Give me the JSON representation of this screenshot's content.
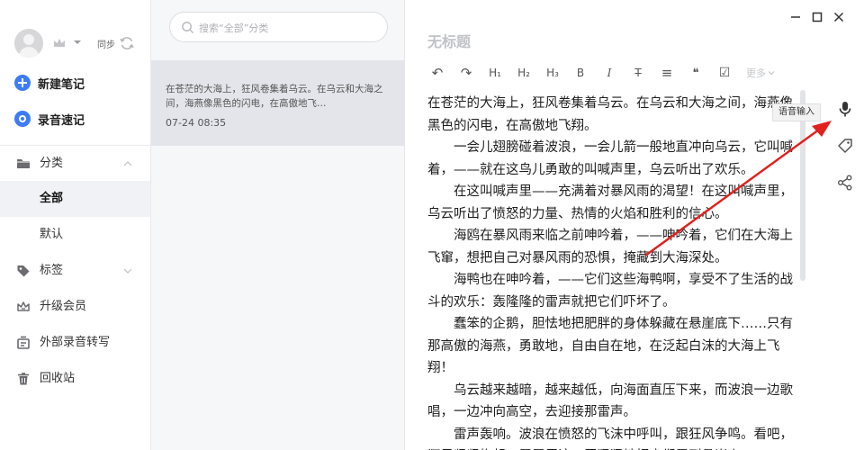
{
  "sidebar": {
    "sync_label": "同步",
    "new_note_label": "新建笔记",
    "voice_note_label": "录音速记",
    "nav": {
      "category": "分类",
      "all": "全部",
      "default": "默认",
      "tags": "标签",
      "upgrade": "升级会员",
      "transcribe": "外部录音转写",
      "trash": "回收站"
    }
  },
  "notelist": {
    "search_placeholder": "搜索“全部”分类",
    "notes": [
      {
        "excerpt": "在苍茫的大海上，狂风卷集着乌云。在乌云和大海之间，海燕像黑色的闪电，在高傲地飞…",
        "date": "07-24 08:35"
      }
    ]
  },
  "editor": {
    "title": "无标题",
    "toolbar": {
      "undo": "↶",
      "redo": "↷",
      "h1": "H₁",
      "h2": "H₂",
      "h3": "H₃",
      "bold": "B",
      "italic": "I",
      "strike": "T",
      "align": "≡",
      "quote": "❝",
      "checkbox": "☑",
      "more": "更多"
    },
    "tooltip": "语音输入",
    "paragraphs": [
      "在苍茫的大海上，狂风卷集着乌云。在乌云和大海之间，海燕像黑色的闪电，在高傲地飞翔。",
      "一会儿翅膀碰着波浪，一会儿箭一般地直冲向乌云，它叫喊着，——就在这鸟儿勇敢的叫喊声里，乌云听出了欢乐。",
      "在这叫喊声里——充满着对暴风雨的渴望！在这叫喊声里，乌云听出了愤怒的力量、热情的火焰和胜利的信心。",
      "海鸥在暴风雨来临之前呻吟着，——呻吟着，它们在大海上飞窜，想把自己对暴风雨的恐惧，掩藏到大海深处。",
      "海鸭也在呻吟着，——它们这些海鸭啊，享受不了生活的战斗的欢乐：轰隆隆的雷声就把它们吓坏了。",
      "蠢笨的企鹅，胆怯地把肥胖的身体躲藏在悬崖底下……只有那高傲的海燕，勇敢地，自由自在地，在泛起白沫的大海上飞翔！",
      "乌云越来越暗，越来越低，向海面直压下来，而波浪一边歌唱，一边冲向高空，去迎接那雷声。",
      "雷声轰响。波浪在愤怒的飞沫中呼叫，跟狂风争鸣。看吧，狂风紧紧抱起一层层巨浪，恶狠狠地把它们甩到悬崖上。"
    ]
  },
  "colors": {
    "accent": "#3d7cf4",
    "arrow": "#e0211c",
    "active_bg": "#f1f2f5",
    "list_bg": "#f6f7f9",
    "selected_card": "#e3e5ea"
  }
}
